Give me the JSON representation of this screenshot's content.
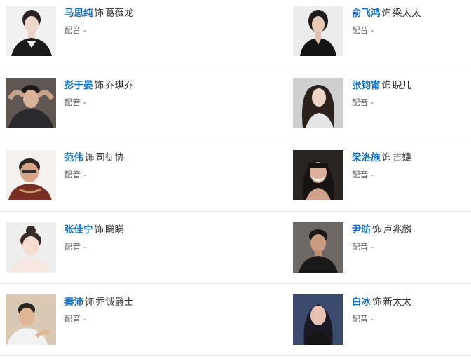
{
  "cast": [
    {
      "actor": "马思纯",
      "sep": "饰",
      "role": "葛薇龙",
      "dub_label": "配音",
      "dub_value": "-"
    },
    {
      "actor": "俞飞鸿",
      "sep": "饰",
      "role": "梁太太",
      "dub_label": "配音",
      "dub_value": "-"
    },
    {
      "actor": "彭于晏",
      "sep": "饰",
      "role": "乔琪乔",
      "dub_label": "配音",
      "dub_value": "-"
    },
    {
      "actor": "张钧甯",
      "sep": "饰",
      "role": "睨儿",
      "dub_label": "配音",
      "dub_value": "-"
    },
    {
      "actor": "范伟",
      "sep": "饰",
      "role": "司徒协",
      "dub_label": "配音",
      "dub_value": "-"
    },
    {
      "actor": "梁洛施",
      "sep": "饰",
      "role": "吉婕",
      "dub_label": "配音",
      "dub_value": "-"
    },
    {
      "actor": "张佳宁",
      "sep": "饰",
      "role": "睇睇",
      "dub_label": "配音",
      "dub_value": "-"
    },
    {
      "actor": "尹昉",
      "sep": "饰",
      "role": "卢兆麟",
      "dub_label": "配音",
      "dub_value": "-"
    },
    {
      "actor": "秦沛",
      "sep": "饰",
      "role": "乔诚爵士",
      "dub_label": "配音",
      "dub_value": "-"
    },
    {
      "actor": "白冰",
      "sep": "饰",
      "role": "新太太",
      "dub_label": "配音",
      "dub_value": "-"
    }
  ],
  "colors": {
    "actor_link": "#136ec2",
    "role_text": "#333333",
    "meta_text": "#666666",
    "divider": "#e9e9e9"
  },
  "icons": {
    "photo": "actor-photo"
  }
}
